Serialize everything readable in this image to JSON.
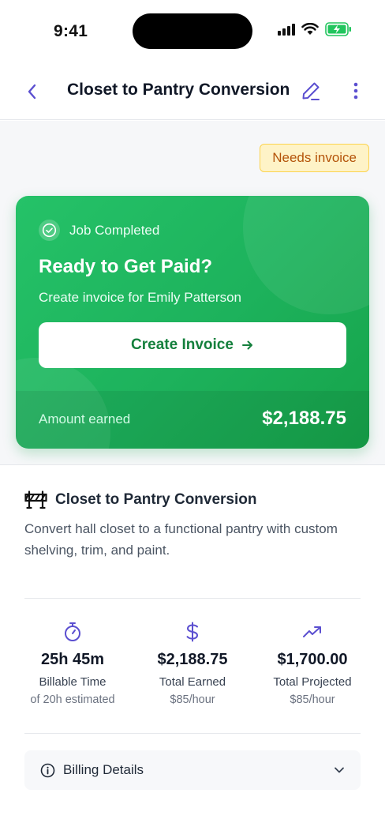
{
  "status_bar": {
    "time": "9:41"
  },
  "nav": {
    "title": "Closet to Pantry Conversion",
    "back_icon": "chevron-left-icon",
    "edit_icon": "pencil-icon",
    "more_icon": "more-vertical-icon"
  },
  "badge": {
    "label": "Needs invoice",
    "bg": "#fef3c7",
    "color": "#b45309"
  },
  "paid_card": {
    "status": "Job Completed",
    "heading": "Ready to Get Paid?",
    "subtitle": "Create invoice for Emily Patterson",
    "button_label": "Create Invoice",
    "amount_label": "Amount earned",
    "amount_value": "$2,188.75",
    "accent": "#22c55e"
  },
  "job": {
    "title": "Closet to Pantry Conversion",
    "description": "Convert hall closet to a functional pantry with custom shelving, trim, and paint.",
    "icon": "road-barrier-icon"
  },
  "stats": [
    {
      "icon": "stopwatch-icon",
      "value": "25h 45m",
      "label": "Billable Time",
      "sub": "of 20h estimated"
    },
    {
      "icon": "dollar-icon",
      "value": "$2,188.75",
      "label": "Total Earned",
      "sub": "$85/hour"
    },
    {
      "icon": "trending-up-icon",
      "value": "$1,700.00",
      "label": "Total Projected",
      "sub": "$85/hour"
    }
  ],
  "billing": {
    "label": "Billing Details",
    "icon": "info-icon",
    "chevron": "chevron-down-icon"
  },
  "colors": {
    "brand_purple": "#5b4fd0",
    "green": "#1db25c"
  }
}
